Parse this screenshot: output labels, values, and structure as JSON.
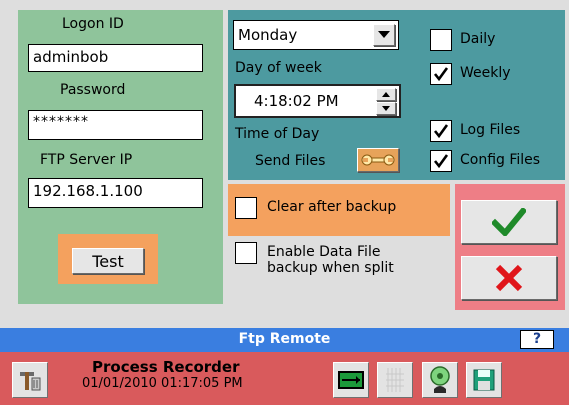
{
  "login": {
    "logon_id_label": "Logon ID",
    "logon_id_value": "adminbob",
    "password_label": "Password",
    "password_value": "*******",
    "ftp_label": "FTP Server IP",
    "ftp_value": "192.168.1.100",
    "test_label": "Test"
  },
  "schedule": {
    "day_value": "Monday",
    "day_caption": "Day of week",
    "time_value": "4:18:02 PM",
    "time_caption": "Time of Day",
    "send_files_label": "Send Files"
  },
  "checks": {
    "daily": {
      "label": "Daily",
      "checked": false
    },
    "weekly": {
      "label": "Weekly",
      "checked": true
    },
    "log_files": {
      "label": "Log Files",
      "checked": true
    },
    "config_files": {
      "label": "Config Files",
      "checked": true
    },
    "clear_after_backup": {
      "label": "Clear after backup",
      "checked": false
    },
    "enable_split_line1": "Enable Data File",
    "enable_split_line2": "backup when split"
  },
  "titlebar": {
    "title": "Ftp Remote",
    "help": "?"
  },
  "status": {
    "app_name": "Process Recorder",
    "datetime": "01/01/2010 01:17:05 PM"
  },
  "colors": {
    "left_panel": "#8fc49b",
    "right_panel": "#4d9aa0",
    "orange": "#f4a15e",
    "pink": "#ee7e86",
    "titlebar": "#3a7ee0",
    "statusbar": "#d95a5c"
  },
  "icons": [
    "tools-icon",
    "network-icon",
    "grid-icon",
    "globe-person-icon",
    "save-disk-icon",
    "wrench-icon",
    "ok-check-icon",
    "cancel-x-icon"
  ]
}
